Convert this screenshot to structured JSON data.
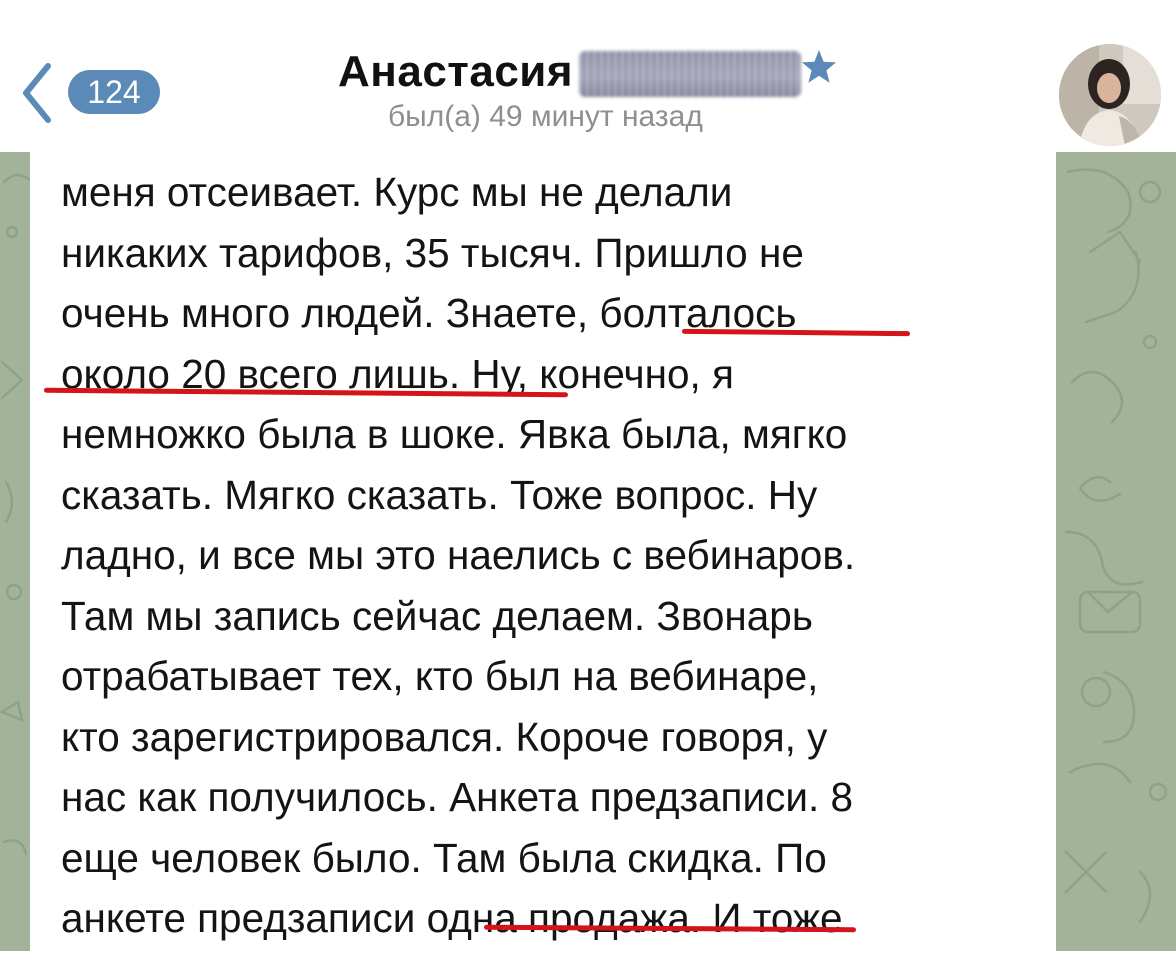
{
  "header": {
    "back_count": "124",
    "contact_name": "Анастасия",
    "status": "был(а) 49 минут назад",
    "icons": {
      "back": "chevron-left-icon",
      "star": "star-icon",
      "avatar": "contact-avatar"
    }
  },
  "message": {
    "lines": [
      "меня отсеивает. Курс мы не делали",
      "никаких тарифов, 35 тысяч. Пришло не",
      "очень много людей. Знаете, болталось",
      "около 20 всего лишь. Ну, конечно, я",
      "немножко была в шоке. Явка была, мягко",
      "сказать. Мягко сказать. Тоже вопрос. Ну",
      "ладно, и все мы это наелись с вебинаров.",
      "Там мы запись сейчас делаем. Звонарь",
      "отрабатывает тех, кто был на вебинаре,",
      "кто зарегистрировался. Короче говоря, у",
      "нас как получилось. Анкета предзаписи. 8",
      "еще человек было. Там была скидка. По",
      "анкете предзаписи одна продажа. И тоже"
    ],
    "highlighted": [
      "болталось",
      "около 20 всего лишь. Н",
      "одна продажа. И"
    ]
  },
  "colors": {
    "accent": "#5b8ab8",
    "underline": "#d4141b",
    "wallpaper": "#a2b39a",
    "status_text": "#8e8e93"
  }
}
